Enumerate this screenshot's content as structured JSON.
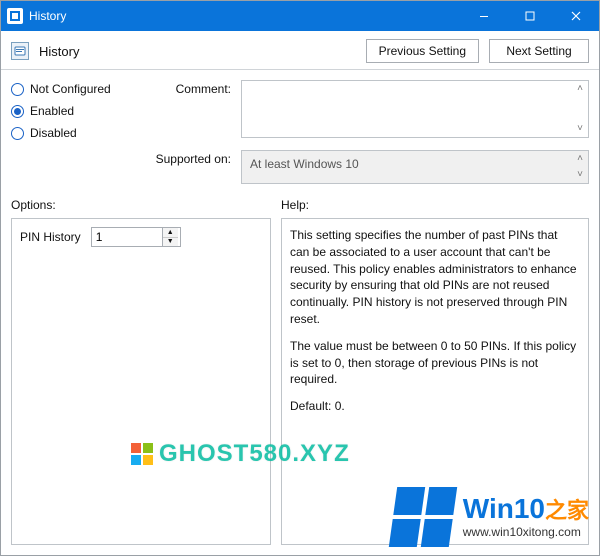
{
  "titlebar": {
    "title": "History"
  },
  "header": {
    "title": "History",
    "prev_btn": "Previous Setting",
    "next_btn": "Next Setting"
  },
  "state": {
    "not_configured": "Not Configured",
    "enabled": "Enabled",
    "disabled": "Disabled",
    "selected": "enabled"
  },
  "labels": {
    "comment": "Comment:",
    "supported": "Supported on:",
    "options": "Options:",
    "help": "Help:"
  },
  "comment_value": "",
  "supported_value": "At least Windows 10",
  "options_panel": {
    "pin_history_label": "PIN History",
    "pin_history_value": "1"
  },
  "help_panel": {
    "p1": "This setting specifies the number of past PINs that can be associated to a user account that can't be reused. This policy enables administrators to enhance security by ensuring that old PINs are not reused continually. PIN history is not preserved through PIN reset.",
    "p2": "The value must be between 0 to 50 PINs. If this policy is set to 0, then storage of previous PINs is not required.",
    "p3": "Default: 0."
  },
  "watermark1": "GHOST580.XYZ",
  "watermark2_main": "Win10",
  "watermark2_accent": "之家",
  "watermark2_url": "www.win10xitong.com"
}
